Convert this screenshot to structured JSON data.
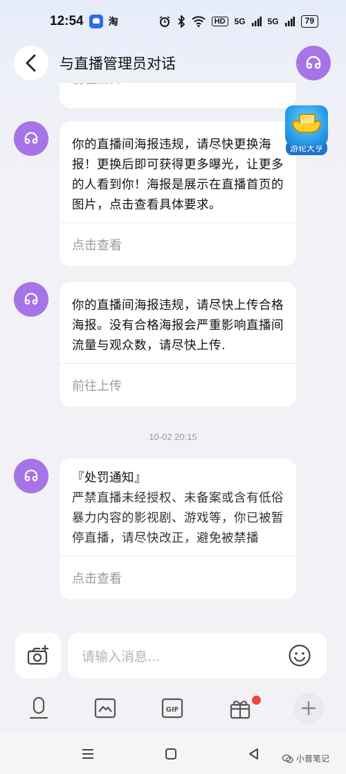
{
  "status_bar": {
    "time": "12:54",
    "taobao": "淘",
    "hd": "HD",
    "sig1": "5G",
    "sig2": "5G",
    "battery": "79"
  },
  "header": {
    "title": "与直播管理员对话"
  },
  "messages": [
    {
      "head": "",
      "body": "",
      "action": "前往上传"
    },
    {
      "head": "你的直播间海报违规，请尽快更换海报！更换后即可获得更多曝光，让更多的人看到你！海报是展示在直播首页的图片，点击查看具体要求。",
      "body": "",
      "action": "点击查看"
    },
    {
      "head": "你的直播间海报违规，请尽快上传合格海报。没有合格海报会严重影响直播间流量与观众数，请尽快上传.",
      "body": "",
      "action": "前往上传"
    },
    {
      "head": "『处罚通知』",
      "body": "严禁直播未经授权、未备案或含有低俗暴力内容的影视剧、游戏等，你已被暂停直播，请尽快改正，避免被禁播",
      "action": "点击查看"
    }
  ],
  "timestamp": "10-02 20:15",
  "floating_game": {
    "label": "游轮大亨"
  },
  "composer": {
    "placeholder": "请输入消息..."
  },
  "watermark": "小普笔记",
  "colors": {
    "accent": "#a774e8",
    "notify": "#f0443c"
  }
}
